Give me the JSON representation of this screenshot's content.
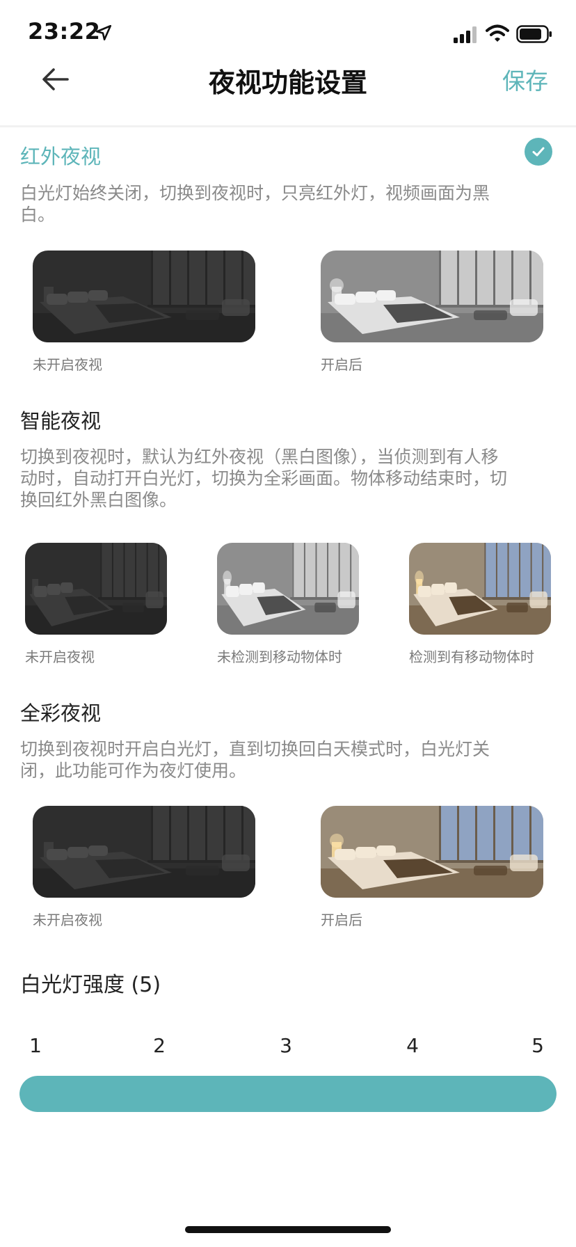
{
  "status_bar": {
    "time": "23:22"
  },
  "header": {
    "title": "夜视功能设置",
    "save_label": "保存"
  },
  "modes": [
    {
      "title": "红外夜视",
      "selected": true,
      "description": "白光灯始终关闭，切换到夜视时，只亮红外灯，视频画面为黑白。",
      "images": [
        {
          "caption": "未开启夜视",
          "style": "dark"
        },
        {
          "caption": "开启后",
          "style": "grayscale"
        }
      ]
    },
    {
      "title": "智能夜视",
      "selected": false,
      "description": "切换到夜视时，默认为红外夜视（黑白图像），当侦测到有人移动时，自动打开白光灯，切换为全彩画面。物体移动结束时，切换回红外黑白图像。",
      "images": [
        {
          "caption": "未开启夜视",
          "style": "dark"
        },
        {
          "caption": "未检测到移动物体时",
          "style": "grayscale"
        },
        {
          "caption": "检测到有移动物体时",
          "style": "color"
        }
      ]
    },
    {
      "title": "全彩夜视",
      "selected": false,
      "description": "切换到夜视时开启白光灯，直到切换回白天模式时，白光灯关闭，此功能可作为夜灯使用。",
      "images": [
        {
          "caption": "未开启夜视",
          "style": "dark"
        },
        {
          "caption": "开启后",
          "style": "color"
        }
      ]
    }
  ],
  "white_light": {
    "title": "白光灯强度 (5)",
    "ticks": [
      "1",
      "2",
      "3",
      "4",
      "5"
    ],
    "value": 5,
    "min": 1,
    "max": 5
  },
  "colors": {
    "accent": "#5db5b9",
    "track": "#e3e3e3"
  }
}
